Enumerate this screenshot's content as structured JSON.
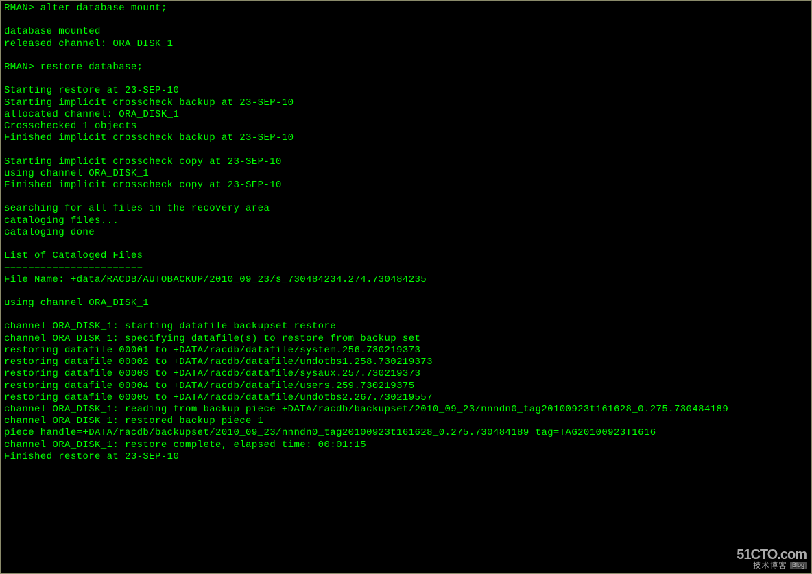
{
  "terminal": {
    "lines": [
      "RMAN> alter database mount;",
      "",
      "database mounted",
      "released channel: ORA_DISK_1",
      "",
      "RMAN> restore database;",
      "",
      "Starting restore at 23-SEP-10",
      "Starting implicit crosscheck backup at 23-SEP-10",
      "allocated channel: ORA_DISK_1",
      "Crosschecked 1 objects",
      "Finished implicit crosscheck backup at 23-SEP-10",
      "",
      "Starting implicit crosscheck copy at 23-SEP-10",
      "using channel ORA_DISK_1",
      "Finished implicit crosscheck copy at 23-SEP-10",
      "",
      "searching for all files in the recovery area",
      "cataloging files...",
      "cataloging done",
      "",
      "List of Cataloged Files",
      "=======================",
      "File Name: +data/RACDB/AUTOBACKUP/2010_09_23/s_730484234.274.730484235",
      "",
      "using channel ORA_DISK_1",
      "",
      "channel ORA_DISK_1: starting datafile backupset restore",
      "channel ORA_DISK_1: specifying datafile(s) to restore from backup set",
      "restoring datafile 00001 to +DATA/racdb/datafile/system.256.730219373",
      "restoring datafile 00002 to +DATA/racdb/datafile/undotbs1.258.730219373",
      "restoring datafile 00003 to +DATA/racdb/datafile/sysaux.257.730219373",
      "restoring datafile 00004 to +DATA/racdb/datafile/users.259.730219375",
      "restoring datafile 00005 to +DATA/racdb/datafile/undotbs2.267.730219557",
      "channel ORA_DISK_1: reading from backup piece +DATA/racdb/backupset/2010_09_23/nnndn0_tag20100923t161628_0.275.730484189",
      "channel ORA_DISK_1: restored backup piece 1",
      "piece handle=+DATA/racdb/backupset/2010_09_23/nnndn0_tag20100923t161628_0.275.730484189 tag=TAG20100923T1616",
      "channel ORA_DISK_1: restore complete, elapsed time: 00:01:15",
      "Finished restore at 23-SEP-10"
    ]
  },
  "watermark": {
    "site": "51CTO.com",
    "subtitle": "技术博客",
    "tag": "Blog"
  }
}
